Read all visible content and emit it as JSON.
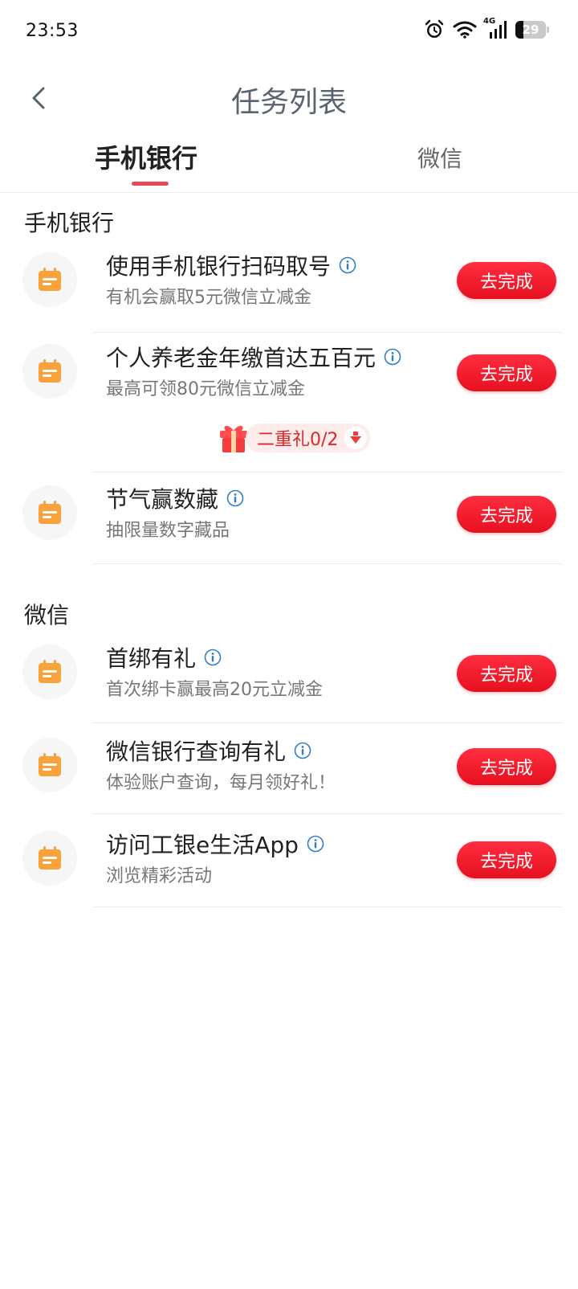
{
  "status_bar": {
    "time": "23:53",
    "network": "4G",
    "battery": "29",
    "icons": [
      "alarm-icon",
      "wifi-icon",
      "signal-icon",
      "battery-icon"
    ]
  },
  "header": {
    "title": "任务列表",
    "back_icon": "chevron-left-icon"
  },
  "tabs": [
    {
      "label": "手机银行",
      "active": true
    },
    {
      "label": "微信",
      "active": false
    }
  ],
  "sections": [
    {
      "title": "手机银行",
      "tasks": [
        {
          "title": "使用手机银行扫码取号",
          "subtitle": "有机会赢取5元微信立减金",
          "button": "去完成"
        },
        {
          "title": "个人养老金年缴首达五百元",
          "subtitle": "最高可领80元微信立减金",
          "button": "去完成",
          "gift": "二重礼0/2"
        },
        {
          "title": "节气赢数藏",
          "subtitle": "抽限量数字藏品",
          "button": "去完成"
        }
      ]
    },
    {
      "title": "微信",
      "tasks": [
        {
          "title": "首绑有礼",
          "subtitle": "首次绑卡赢最高20元立减金",
          "button": "去完成"
        },
        {
          "title": "微信银行查询有礼",
          "subtitle": "体验账户查询，每月领好礼！",
          "button": "去完成"
        },
        {
          "title": "访问工银e生活App",
          "subtitle": "浏览精彩活动",
          "button": "去完成"
        }
      ]
    }
  ],
  "colors": {
    "accent": "#e84a55",
    "button": "#f01a2c",
    "task_icon": "#f7a23a",
    "info_icon": "#2f7ec7"
  }
}
